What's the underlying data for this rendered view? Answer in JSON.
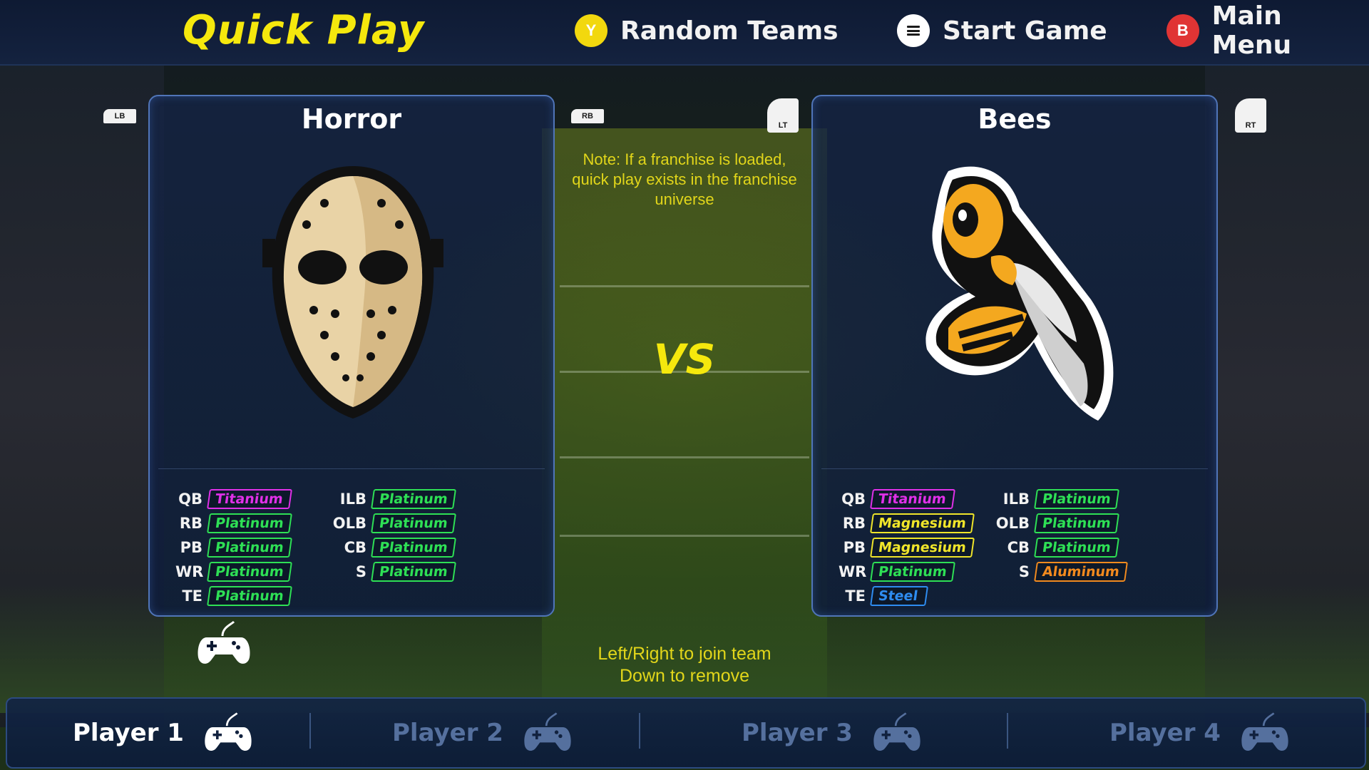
{
  "header": {
    "title": "Quick Play",
    "buttons": [
      {
        "key": "Y",
        "icon": "y-button-icon",
        "label": "Random Teams",
        "color": "#f2d80e"
      },
      {
        "key": "",
        "icon": "menu-button-icon",
        "label": "Start Game",
        "color": "#ffffff"
      },
      {
        "key": "B",
        "icon": "b-button-icon",
        "label": "Main Menu",
        "color": "#e03434"
      }
    ]
  },
  "shoulders": {
    "lb": "LB",
    "rb": "RB",
    "lt": "LT",
    "rt": "RT"
  },
  "note": "Note:  If a franchise is loaded, quick play exists in the franchise universe",
  "vs": "VS",
  "hint": {
    "line1": "Left/Right to join team",
    "line2": "Down to remove"
  },
  "teams": [
    {
      "name": "Horror",
      "logo_icon": "hockey-mask-icon",
      "roster_left": [
        {
          "pos": "QB",
          "tier": "Titanium"
        },
        {
          "pos": "RB",
          "tier": "Platinum"
        },
        {
          "pos": "PB",
          "tier": "Platinum"
        },
        {
          "pos": "WR",
          "tier": "Platinum"
        },
        {
          "pos": "TE",
          "tier": "Platinum"
        }
      ],
      "roster_right": [
        {
          "pos": "ILB",
          "tier": "Platinum"
        },
        {
          "pos": "OLB",
          "tier": "Platinum"
        },
        {
          "pos": "CB",
          "tier": "Platinum"
        },
        {
          "pos": "S",
          "tier": "Platinum"
        }
      ]
    },
    {
      "name": "Bees",
      "logo_icon": "hornet-icon",
      "roster_left": [
        {
          "pos": "QB",
          "tier": "Titanium"
        },
        {
          "pos": "RB",
          "tier": "Magnesium"
        },
        {
          "pos": "PB",
          "tier": "Magnesium"
        },
        {
          "pos": "WR",
          "tier": "Platinum"
        },
        {
          "pos": "TE",
          "tier": "Steel"
        }
      ],
      "roster_right": [
        {
          "pos": "ILB",
          "tier": "Platinum"
        },
        {
          "pos": "OLB",
          "tier": "Platinum"
        },
        {
          "pos": "CB",
          "tier": "Platinum"
        },
        {
          "pos": "S",
          "tier": "Aluminum"
        }
      ]
    }
  ],
  "players": [
    {
      "name": "Player 1",
      "active": true,
      "icon": "gamepad-icon"
    },
    {
      "name": "Player 2",
      "active": false,
      "icon": "gamepad-icon"
    },
    {
      "name": "Player 3",
      "active": false,
      "icon": "gamepad-icon"
    },
    {
      "name": "Player 4",
      "active": false,
      "icon": "gamepad-icon"
    }
  ],
  "colors": {
    "title": "#f5e80d",
    "note": "#e2d61a",
    "panel_border": "#5075b8",
    "tier_titanium": "#e030e8",
    "tier_platinum": "#2ee055",
    "tier_magnesium": "#f0e52a",
    "tier_aluminum": "#f28a1e",
    "tier_steel": "#2e8cf0"
  }
}
